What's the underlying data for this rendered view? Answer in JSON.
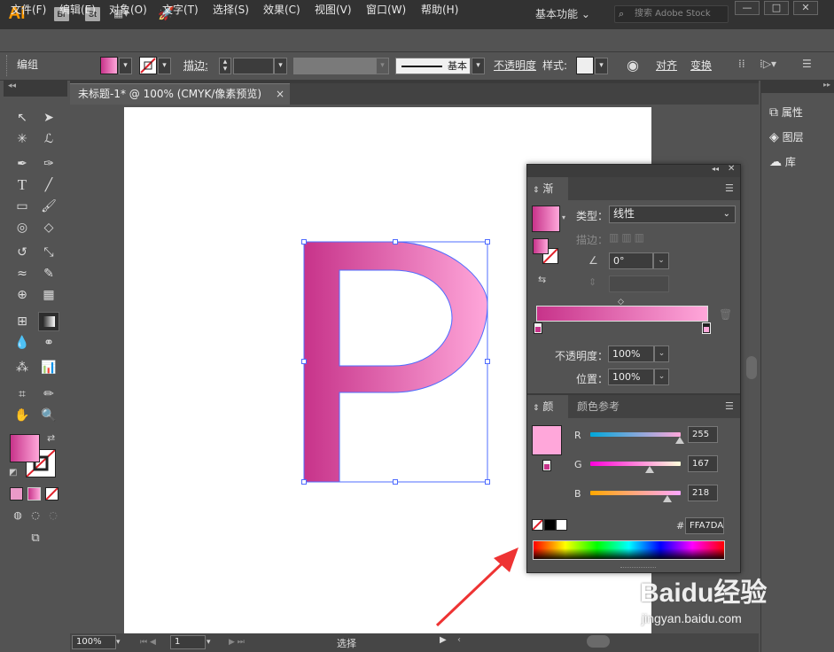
{
  "app": {
    "logo": "Ai",
    "bridge": "Br",
    "stock": "St",
    "workspace": "基本功能",
    "search_placeholder": "搜索 Adobe Stock"
  },
  "window_controls": {
    "min": "—",
    "max": "□",
    "close": "✕"
  },
  "menu": [
    "文件(F)",
    "编辑(E)",
    "对象(O)",
    "文字(T)",
    "选择(S)",
    "效果(C)",
    "视图(V)",
    "窗口(W)",
    "帮助(H)"
  ],
  "control_bar": {
    "selection_label": "编组",
    "stroke_label": "描边",
    "stroke_profile": "基本",
    "opacity_label": "不透明度",
    "style_label": "样式",
    "align_label": "对齐",
    "transform_label": "变换"
  },
  "document_tab": {
    "title": "未标题-1* @ 100% (CMYK/像素预览)",
    "close": "×"
  },
  "artboard": {
    "letter": "P"
  },
  "right_dock": [
    "属性",
    "图层",
    "库"
  ],
  "gradient_panel": {
    "title": "渐变",
    "type_label": "类型",
    "type_value": "线性",
    "stroke_label": "描边",
    "angle_value": "0°",
    "opacity_label": "不透明度",
    "opacity_value": "100%",
    "position_label": "位置",
    "position_value": "100%",
    "gradient_start": "#c7338a",
    "gradient_end": "#ffa7da"
  },
  "color_panel": {
    "tab_color": "颜色",
    "tab_guide": "颜色参考",
    "r_label": "R",
    "r_value": "255",
    "g_label": "G",
    "g_value": "167",
    "b_label": "B",
    "b_value": "218",
    "hash": "#",
    "hex_value": "FFA7DA",
    "current_color": "#ffa7da"
  },
  "status_bar": {
    "zoom": "100%",
    "page": "1",
    "status_text": "选择"
  },
  "watermark": {
    "brand": "Baidu经验",
    "url": "jingyan.baidu.com"
  }
}
